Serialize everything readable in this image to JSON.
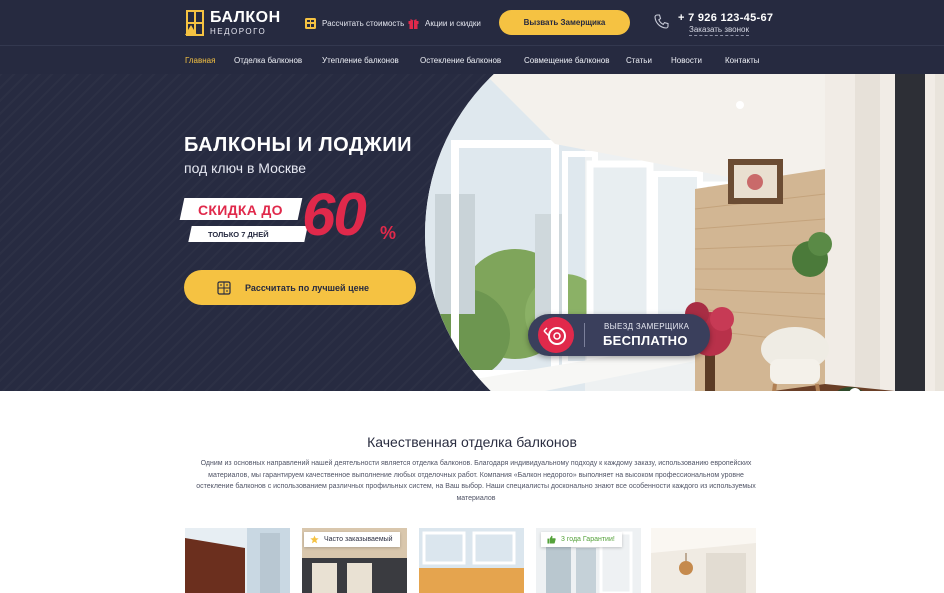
{
  "header": {
    "logo_line1": "БАЛКОН",
    "logo_line2": "НЕДОРОГО",
    "calc_link": "Рассчитать стоимость",
    "promo_link": "Акции и скидки",
    "measurer_button": "Вызвать Замерщика",
    "phone": "+ 7 926 123-45-67",
    "callback": "Заказать звонок"
  },
  "nav": {
    "items": [
      "Главная",
      "Отделка балконов",
      "Утепление балконов",
      "Остекление балконов",
      "Совмещение балконов",
      "Статьи",
      "Новости",
      "Контакты"
    ]
  },
  "hero": {
    "title": "БАЛКОНЫ И ЛОДЖИИ",
    "subtitle": "под ключ в Москве",
    "discount_label": "СКИДКА ДО",
    "discount_value": "60",
    "discount_unit": "%",
    "discount_note": "ТОЛЬКО 7 ДНЕЙ",
    "cta_button": "Рассчитать по лучшей цене",
    "badge_line1": "ВЫЕЗД ЗАМЕРЩИКА",
    "badge_line2": "БЕСПЛАТНО"
  },
  "content": {
    "title": "Качественная отделка балконов",
    "description": "Одним из основных направлений нашей деятельности является отделка балконов. Благодаря индивидуальному подходу к каждому заказу, использованию европейских материалов, мы гарантируем качественное выполнение любых отделочных работ. Компания «Балкон недорого» выполняет на высоком профессиональном уровне остекление балконов с использованием различных профильных систем, на Ваш выбор. Наши специалисты досконально знают все особенности каждого из используемых материалов",
    "badge_popular": "Часто заказываемый",
    "badge_warranty": "3 года Гарантии!"
  },
  "colors": {
    "dark": "#262a40",
    "accent_yellow": "#f5c242",
    "accent_red": "#e0294b"
  },
  "icons": [
    "calculator-icon",
    "gift-icon",
    "phone-icon",
    "tape-measure-icon",
    "star-icon",
    "thumbs-up-icon"
  ]
}
